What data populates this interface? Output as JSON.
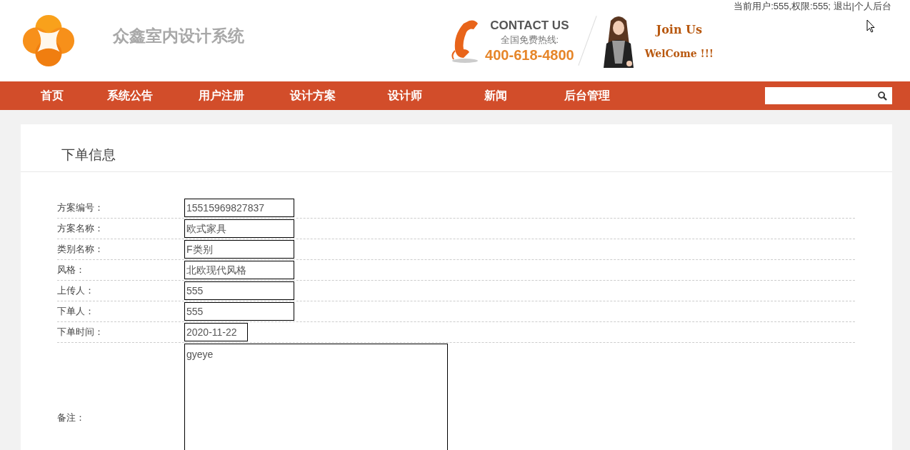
{
  "header": {
    "site_title": "众鑫室内设计系统",
    "user_info": "当前用户:555,权限:555;",
    "logout_link": "退出",
    "separator": "|",
    "backend_link": "个人后台",
    "contact": {
      "heading": "CONTACT US",
      "hotline_label": "全国免费热线:",
      "phone": "400-618-4800"
    },
    "join": {
      "line1": "Join Us",
      "line2": "WelCome !!!"
    }
  },
  "nav": {
    "items": [
      {
        "label": "首页"
      },
      {
        "label": "系统公告"
      },
      {
        "label": "用户注册"
      },
      {
        "label": "设计方案"
      },
      {
        "label": "设计师"
      },
      {
        "label": "新闻"
      },
      {
        "label": "后台管理"
      }
    ]
  },
  "panel": {
    "title": "下单信息",
    "fields": [
      {
        "label": "方案编号：",
        "value": "15515969827837",
        "kind": "text"
      },
      {
        "label": "方案名称：",
        "value": "欧式家具",
        "kind": "text"
      },
      {
        "label": "类别名称：",
        "value": "F类别",
        "kind": "text"
      },
      {
        "label": "风格：",
        "value": "北欧现代风格",
        "kind": "text"
      },
      {
        "label": "上传人：",
        "value": "555",
        "kind": "text"
      },
      {
        "label": "下单人：",
        "value": "555",
        "kind": "text"
      },
      {
        "label": "下单时间：",
        "value": "2020-11-22",
        "kind": "date"
      },
      {
        "label": "备注：",
        "value": "gyeye",
        "kind": "textarea"
      }
    ]
  }
}
